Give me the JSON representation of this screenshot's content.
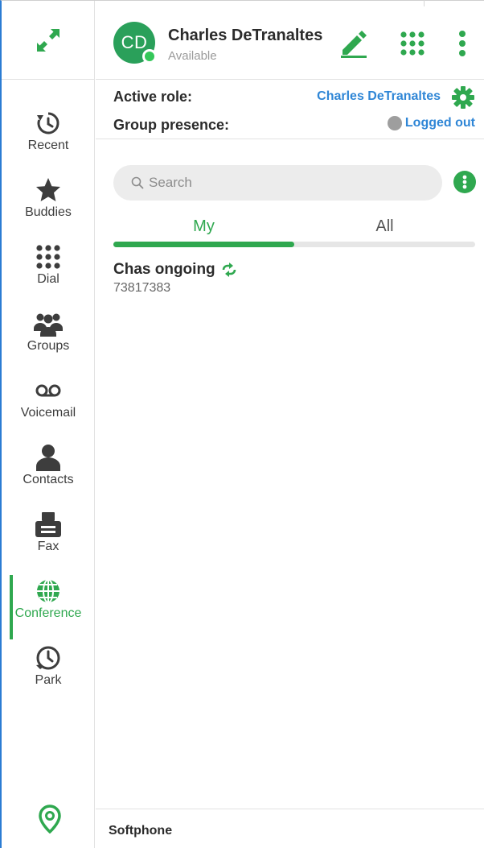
{
  "header": {
    "avatar_initials": "CD",
    "user_name": "Charles DeTranaltes",
    "user_status": "Available",
    "buttons": [
      {
        "icon": "pencil-icon",
        "label": "Edit"
      },
      {
        "icon": "dialpad-icon",
        "label": "Dial pad"
      },
      {
        "icon": "more-vertical-icon",
        "label": "More"
      }
    ]
  },
  "role_panel": {
    "active_role_label": "Active role:",
    "active_role_value": "Charles DeTranaltes",
    "group_presence_label": "Group presence:",
    "group_presence_value": "Logged out"
  },
  "sidebar": {
    "expand_icon": "expand-arrows-icon",
    "items": [
      {
        "label": "Recent",
        "icon": "history-icon"
      },
      {
        "label": "Buddies",
        "icon": "star-icon"
      },
      {
        "label": "Dial",
        "icon": "dialpad-icon"
      },
      {
        "label": "Groups",
        "icon": "group-icon"
      },
      {
        "label": "Voicemail",
        "icon": "voicemail-icon"
      },
      {
        "label": "Contacts",
        "icon": "contact-icon"
      },
      {
        "label": "Fax",
        "icon": "fax-icon"
      },
      {
        "label": "Conference",
        "icon": "globe-phone-icon",
        "active": true
      },
      {
        "label": "Park",
        "icon": "clock-phone-icon"
      }
    ],
    "bottom_icon": "location-pin-icon"
  },
  "search": {
    "placeholder": "Search",
    "value": ""
  },
  "tabs": [
    {
      "label": "My",
      "active": true
    },
    {
      "label": "All",
      "active": false
    }
  ],
  "conferences": [
    {
      "title": "Chas ongoing",
      "number": "73817383",
      "icon": "recurring-icon"
    }
  ],
  "footer": {
    "label": "Softphone"
  },
  "colors": {
    "accent_green": "#2fa84f",
    "link_blue": "#2f86d6",
    "presence_gray": "#9e9e9e",
    "window_border": "#2b7cd3"
  }
}
